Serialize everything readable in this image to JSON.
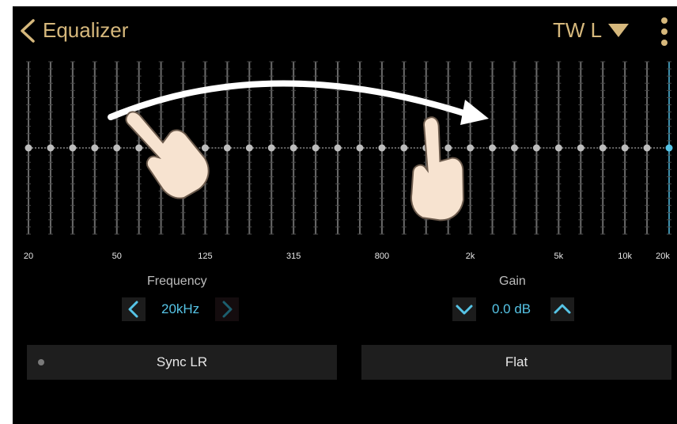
{
  "header": {
    "title": "Equalizer",
    "channel": "TW L"
  },
  "eq": {
    "band_count": 30,
    "selected_band": 29,
    "gains_db": [
      0,
      0,
      0,
      0,
      0,
      0,
      0,
      0,
      0,
      0,
      0,
      0,
      0,
      0,
      0,
      0,
      0,
      0,
      0,
      0,
      0,
      0,
      0,
      0,
      0,
      0,
      0,
      0,
      0,
      0
    ],
    "axis_labels": [
      "20",
      "50",
      "125",
      "315",
      "800",
      "2k",
      "5k",
      "10k",
      "20k"
    ]
  },
  "frequency": {
    "caption": "Frequency",
    "value": "20kHz"
  },
  "gain": {
    "caption": "Gain",
    "value": "0.0 dB"
  },
  "buttons": {
    "sync_lr": "Sync LR",
    "flat": "Flat"
  },
  "colors": {
    "accent_gold": "#d6b87c",
    "accent_cyan": "#56c4e6",
    "background": "#000000"
  },
  "icons": {
    "back": "chevron-left-icon",
    "channel_dropdown": "caret-down-icon",
    "more": "more-vertical-icon",
    "freq_prev": "chevron-left-icon",
    "freq_next": "chevron-right-icon",
    "gain_down": "chevron-down-icon",
    "gain_up": "chevron-up-icon"
  }
}
